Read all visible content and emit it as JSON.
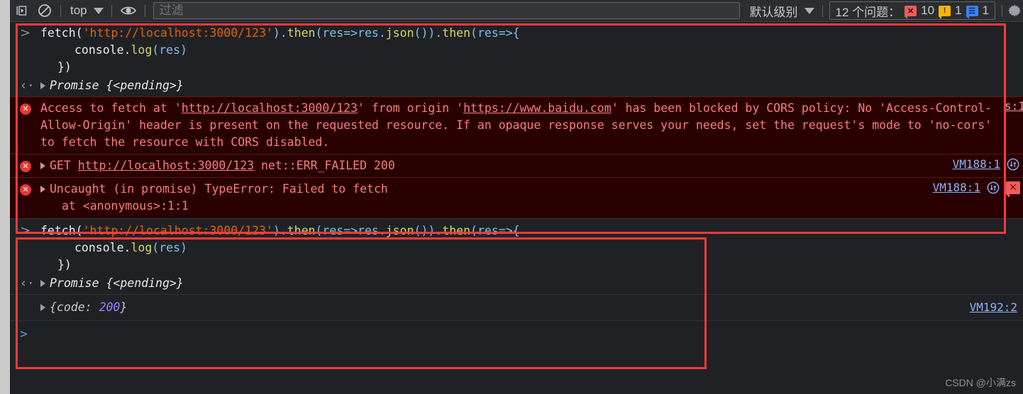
{
  "toolbar": {
    "icons": {
      "step_label": "step-into-icon",
      "clear_label": "clear-console-icon",
      "eye_label": "eye-icon",
      "gear_label": "settings-gear-icon"
    },
    "context_value": "top",
    "filter_placeholder": "过滤",
    "filter_value": "",
    "level_value": "默认级别",
    "issues_label": "12 个问题：",
    "issue_counts": {
      "errors": "10",
      "warnings": "1",
      "info": "1"
    }
  },
  "console": {
    "input_caret": ">",
    "output_caret": "‹·",
    "block1": {
      "code_line1": {
        "p1": "fetch(",
        "p2": "'http://localhost:3000/123'",
        "p3": ").",
        "p4": "then",
        "p5": "(res=>res.",
        "p6": "json",
        "p7": "()).",
        "p8": "then",
        "p9": "(res=>{"
      },
      "code_line2": {
        "p1": "console.",
        "p2": "log",
        "p3": "(res)"
      },
      "code_line3": "})",
      "result": "Promise {<pending>}"
    },
    "errors": [
      {
        "text_before_url1": "Access to fetch at '",
        "url1": "http://localhost:3000/123",
        "text_mid": "' from origin '",
        "url2": "https://www.baidu.com",
        "text_after": "' has been blocked by CORS policy: No 'Access-Control-Allow-Origin' header is present on the requested resource. If an opaque response serves your needs, set the request's mode to 'no-cors' to fetch the resource with CORS disabled.",
        "source": "s:1"
      },
      {
        "method": "GET",
        "url": "http://localhost:3000/123",
        "status_text": "net::ERR_FAILED 200",
        "source": "VM188:1"
      },
      {
        "line1": "Uncaught (in promise) TypeError: Failed to fetch",
        "line2": "at <anonymous>:1:1",
        "source": "VM188:1"
      }
    ],
    "block2": {
      "code_line1": {
        "p1": "fetch(",
        "p2": "'http://localhost:3000/123'",
        "p3": ").",
        "p4": "then",
        "p5": "(res=>res.",
        "p6": "json",
        "p7": "()).",
        "p8": "then",
        "p9": "(res=>{"
      },
      "code_line2": {
        "p1": "console.",
        "p2": "log",
        "p3": "(res)"
      },
      "code_line3": "})",
      "result": "Promise {<pending>}",
      "log_open": "{",
      "log_key": "code",
      "log_colon": ": ",
      "log_value": "200",
      "log_close": "}",
      "log_source": "VM192:2"
    },
    "final_prompt": ">"
  },
  "watermark": "CSDN @小满zs",
  "colors": {
    "accent_red": "#f93a3a",
    "error_bg": "#290000",
    "error_text": "#fd7c7c",
    "link_blue": "#8ab4f8",
    "string_orange": "#e36209"
  }
}
